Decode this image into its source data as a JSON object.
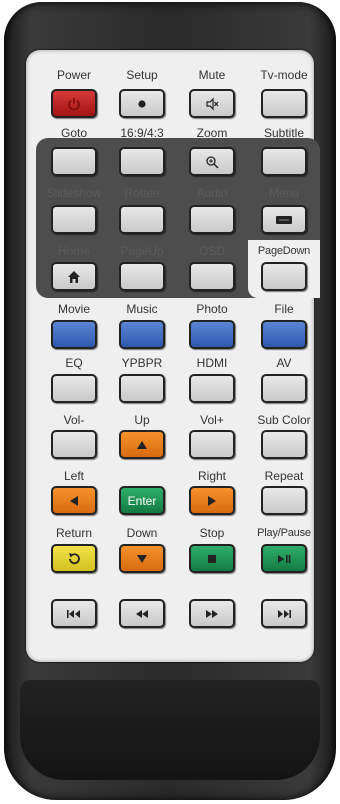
{
  "colors": {
    "red": "#c22a2a",
    "blue": "#3d66bf",
    "orange": "#ea7d1c",
    "green": "#1f9153",
    "yellow": "#e4d232",
    "grey": "#d8d8d8"
  },
  "rows": [
    {
      "labels": [
        "Power",
        "Setup",
        "Mute",
        "Tv-mode"
      ]
    },
    {
      "labels": [
        "Goto",
        "16:9/4:3",
        "Zoom",
        "Subtitle"
      ]
    },
    {
      "labels": [
        "Slideshow",
        "Rotate",
        "Audio",
        "Menu"
      ]
    },
    {
      "labels": [
        "Home",
        "PageUp",
        "OSD",
        "PageDown"
      ]
    },
    {
      "labels": [
        "Movie",
        "Music",
        "Photo",
        "File"
      ]
    },
    {
      "labels": [
        "EQ",
        "YPBPR",
        "HDMI",
        "AV"
      ]
    },
    {
      "labels": [
        "Vol-",
        "Up",
        "Vol+",
        "Sub Color"
      ]
    },
    {
      "labels": [
        "Left",
        "",
        "Right",
        "Repeat"
      ]
    },
    {
      "labels": [
        "Return",
        "Down",
        "Stop",
        "Play/Pause"
      ]
    }
  ],
  "enter_label": "Enter"
}
